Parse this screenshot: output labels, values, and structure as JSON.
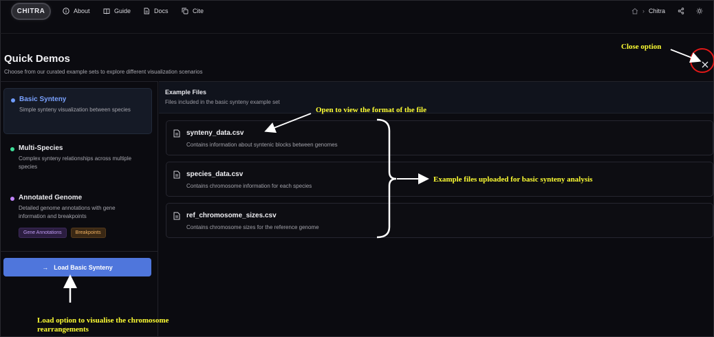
{
  "nav": {
    "logo": "CHITRA",
    "items": [
      {
        "label": "About",
        "icon": "info-icon"
      },
      {
        "label": "Guide",
        "icon": "book-icon"
      },
      {
        "label": "Docs",
        "icon": "document-icon"
      },
      {
        "label": "Cite",
        "icon": "copy-icon"
      }
    ],
    "breadcrumb": "Chitra"
  },
  "header": {
    "title": "Quick Demos",
    "subtitle": "Choose from our curated example sets to explore different visualization scenarios"
  },
  "demos": [
    {
      "name": "Basic Synteny",
      "desc": "Simple synteny visualization between species",
      "dot_color": "#6f9cff",
      "active": true
    },
    {
      "name": "Multi-Species",
      "desc": "Complex synteny relationships across multiple species",
      "dot_color": "#3ddc97",
      "active": false
    },
    {
      "name": "Annotated Genome",
      "desc": "Detailed genome annotations with gene information and breakpoints",
      "dot_color": "#c084fc",
      "active": false,
      "tags": [
        "Gene Annotations",
        "Breakpoints"
      ]
    }
  ],
  "load_button": "Load Basic Synteny",
  "example_files": {
    "title": "Example Files",
    "subtitle": "Files included in the basic synteny example set",
    "files": [
      {
        "name": "synteny_data.csv",
        "desc": "Contains information about syntenic blocks between genomes"
      },
      {
        "name": "species_data.csv",
        "desc": "Contains chromosome information for each species"
      },
      {
        "name": "ref_chromosome_sizes.csv",
        "desc": "Contains chromosome sizes for the reference genome"
      }
    ]
  },
  "annotations": {
    "close": "Close option",
    "view_format": "Open to view the format of the file",
    "example_files": "Example files uploaded for basic synteny analysis",
    "load_line1": "Load option to visualise the chromosome",
    "load_line2": "rearrangements"
  },
  "colors": {
    "accent": "#4f76dc",
    "annotation_text": "#ffff33",
    "highlight_ring": "#e01818"
  }
}
